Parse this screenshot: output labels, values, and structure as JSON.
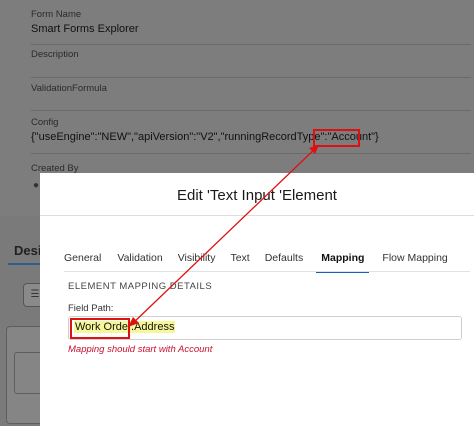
{
  "background_form": {
    "form_name_label": "Form Name",
    "form_name_value": "Smart Forms Explorer",
    "description_label": "Description",
    "validation_formula_label": "ValidationFormula",
    "config_label": "Config",
    "config_value": "{\"useEngine\":\"NEW\",\"apiVersion\":\"V2\",\"runningRecordType\":\"Account\"}",
    "created_by_label": "Created By",
    "design_tab_partial": "Desi"
  },
  "modal": {
    "title": "Edit 'Text Input 'Element",
    "tabs": [
      {
        "label": "General"
      },
      {
        "label": "Validation"
      },
      {
        "label": "Visibility"
      },
      {
        "label": "Text"
      },
      {
        "label": "Defaults"
      },
      {
        "label": "Mapping",
        "active": true
      },
      {
        "label": "Flow Mapping"
      }
    ],
    "section_title": "ELEMENT MAPPING DETAILS",
    "field_path_label": "Field Path:",
    "field_path_value": "Work Order.Address",
    "error_message": "Mapping should start with Account"
  },
  "colors": {
    "accent": "#1b5fb4",
    "error": "#c8102e",
    "annotation": "#dd1111",
    "highlight": "#f7f79a"
  }
}
